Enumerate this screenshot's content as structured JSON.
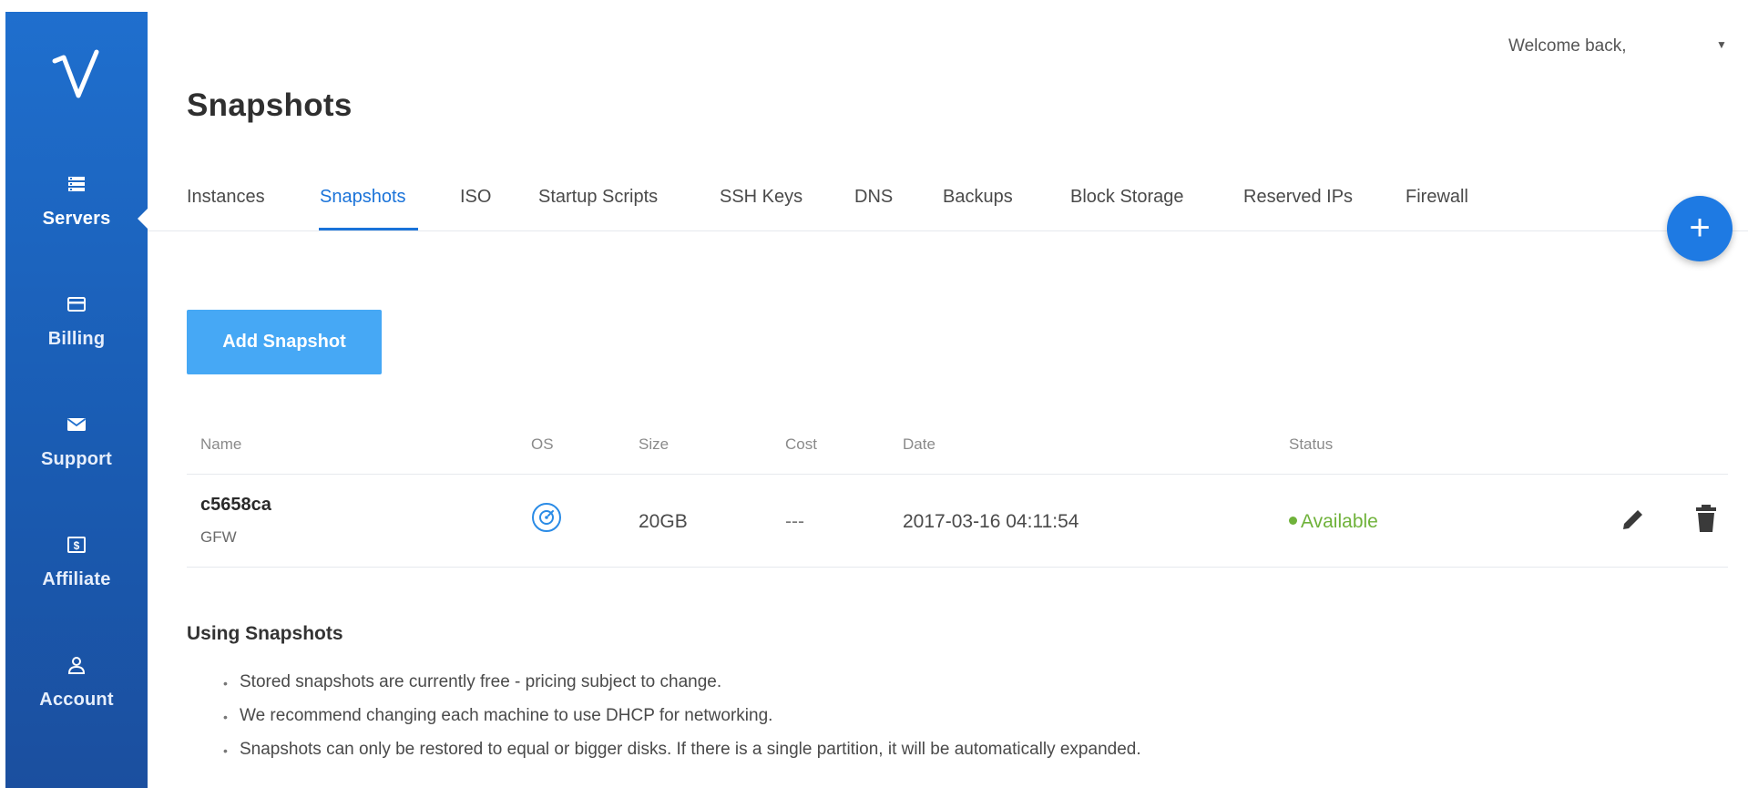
{
  "sidebar": {
    "logo": "V",
    "items": [
      {
        "label": "Servers",
        "icon": "servers-icon",
        "active": true
      },
      {
        "label": "Billing",
        "icon": "credit-card-icon",
        "active": false
      },
      {
        "label": "Support",
        "icon": "envelope-icon",
        "active": false
      },
      {
        "label": "Affiliate",
        "icon": "dollar-icon",
        "active": false
      },
      {
        "label": "Account",
        "icon": "user-icon",
        "active": false
      }
    ]
  },
  "header": {
    "welcome": "Welcome back,",
    "title": "Snapshots"
  },
  "tabs": [
    {
      "label": "Instances"
    },
    {
      "label": "Snapshots",
      "active": true
    },
    {
      "label": "ISO"
    },
    {
      "label": "Startup Scripts"
    },
    {
      "label": "SSH Keys"
    },
    {
      "label": "DNS"
    },
    {
      "label": "Backups"
    },
    {
      "label": "Block Storage"
    },
    {
      "label": "Reserved IPs"
    },
    {
      "label": "Firewall"
    }
  ],
  "fab_label": "+",
  "add_button": "Add Snapshot",
  "table": {
    "headers": [
      "Name",
      "OS",
      "Size",
      "Cost",
      "Date",
      "Status"
    ],
    "rows": [
      {
        "name": "c5658ca",
        "subname": "GFW",
        "os_icon": "disc-icon",
        "size": "20GB",
        "cost": "---",
        "date": "2017-03-16 04:11:54",
        "status": "Available"
      }
    ]
  },
  "info": {
    "title": "Using Snapshots",
    "items": [
      "Stored snapshots are currently free - pricing subject to change.",
      "We recommend changing each machine to use DHCP for networking.",
      "Snapshots can only be restored to equal or bigger disks. If there is a single partition, it will be automatically expanded."
    ]
  },
  "colors": {
    "sidebar": "#1f6fce",
    "accent": "#1a73d9",
    "button": "#46a8f5",
    "status_available": "#6fb23a"
  }
}
